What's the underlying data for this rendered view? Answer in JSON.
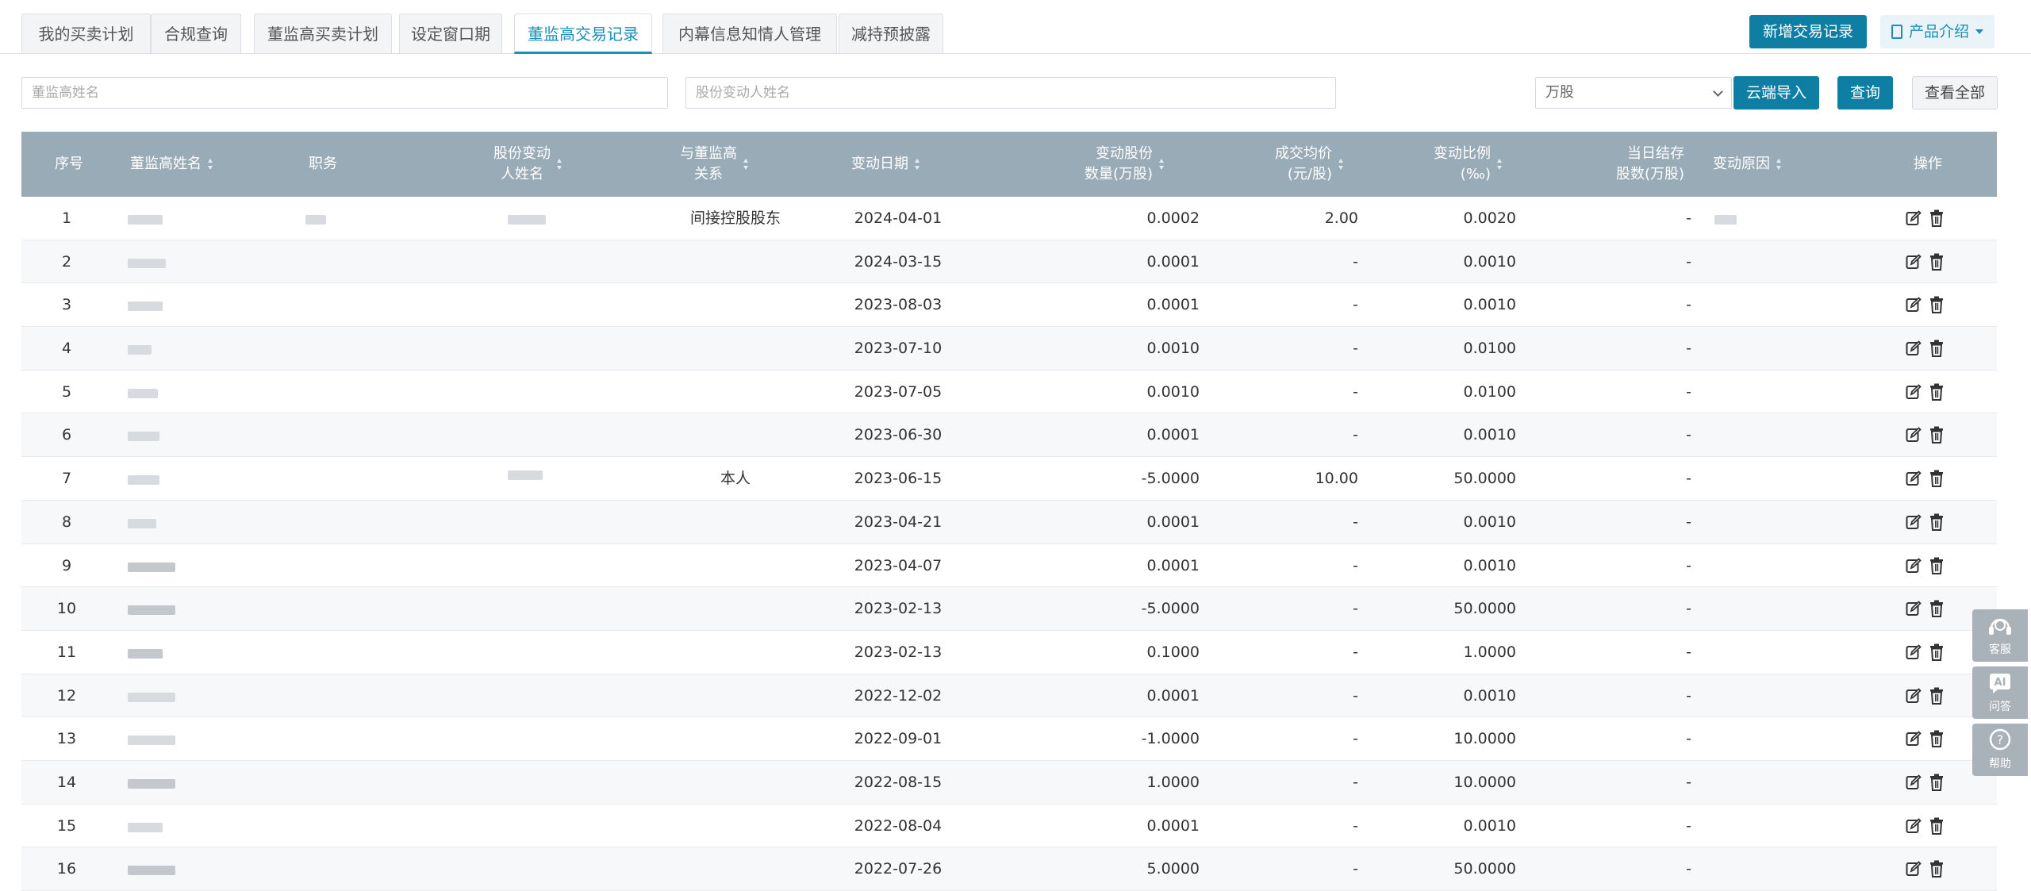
{
  "tabs": [
    {
      "label": "我的买卖计划",
      "active": false
    },
    {
      "label": "合规查询",
      "active": false
    },
    {
      "label": "董监高买卖计划",
      "active": false
    },
    {
      "label": "设定窗口期",
      "active": false
    },
    {
      "label": "董监高交易记录",
      "active": true
    },
    {
      "label": "内幕信息知情人管理",
      "active": false
    },
    {
      "label": "减持预披露",
      "active": false
    }
  ],
  "header_actions": {
    "new_record": "新增交易记录",
    "product_intro": "产品介绍"
  },
  "filters": {
    "name_placeholder": "董监高姓名",
    "changer_placeholder": "股份变动人姓名",
    "select_value": "万股",
    "import_button": "云端导入",
    "query_button": "查询",
    "query_all_button": "查看全部"
  },
  "columns": [
    {
      "label": "序号",
      "sortable": false
    },
    {
      "label": "董监高姓名",
      "sortable": true
    },
    {
      "label": "职务",
      "sortable": false
    },
    {
      "label": "股份变动\n人姓名",
      "sortable": true
    },
    {
      "label": "与董监高\n关系",
      "sortable": true
    },
    {
      "label": "变动日期",
      "sortable": true
    },
    {
      "label": "变动股份\n数量(万股)",
      "sortable": true
    },
    {
      "label": "成交均价\n(元/股)",
      "sortable": true
    },
    {
      "label": "变动比例\n(‰)",
      "sortable": true
    },
    {
      "label": "当日结存\n股数(万股)",
      "sortable": false
    },
    {
      "label": "变动原因",
      "sortable": true
    },
    {
      "label": "操作",
      "sortable": false
    }
  ],
  "rows": [
    {
      "no": "1",
      "relation": "间接控股股东",
      "date": "2024-04-01",
      "qty": "0.0002",
      "price": "2.00",
      "ratio": "0.0020",
      "balance": "-"
    },
    {
      "no": "2",
      "relation": "",
      "date": "2024-03-15",
      "qty": "0.0001",
      "price": "-",
      "ratio": "0.0010",
      "balance": "-"
    },
    {
      "no": "3",
      "relation": "",
      "date": "2023-08-03",
      "qty": "0.0001",
      "price": "-",
      "ratio": "0.0010",
      "balance": "-"
    },
    {
      "no": "4",
      "relation": "",
      "date": "2023-07-10",
      "qty": "0.0010",
      "price": "-",
      "ratio": "0.0100",
      "balance": "-"
    },
    {
      "no": "5",
      "relation": "",
      "date": "2023-07-05",
      "qty": "0.0010",
      "price": "-",
      "ratio": "0.0100",
      "balance": "-"
    },
    {
      "no": "6",
      "relation": "",
      "date": "2023-06-30",
      "qty": "0.0001",
      "price": "-",
      "ratio": "0.0010",
      "balance": "-"
    },
    {
      "no": "7",
      "relation": "本人",
      "date": "2023-06-15",
      "qty": "-5.0000",
      "price": "10.00",
      "ratio": "50.0000",
      "balance": "-"
    },
    {
      "no": "8",
      "relation": "",
      "date": "2023-04-21",
      "qty": "0.0001",
      "price": "-",
      "ratio": "0.0010",
      "balance": "-"
    },
    {
      "no": "9",
      "relation": "",
      "date": "2023-04-07",
      "qty": "0.0001",
      "price": "-",
      "ratio": "0.0010",
      "balance": "-"
    },
    {
      "no": "10",
      "relation": "",
      "date": "2023-02-13",
      "qty": "-5.0000",
      "price": "-",
      "ratio": "50.0000",
      "balance": "-"
    },
    {
      "no": "11",
      "relation": "",
      "date": "2023-02-13",
      "qty": "0.1000",
      "price": "-",
      "ratio": "1.0000",
      "balance": "-"
    },
    {
      "no": "12",
      "relation": "",
      "date": "2022-12-02",
      "qty": "0.0001",
      "price": "-",
      "ratio": "0.0010",
      "balance": "-"
    },
    {
      "no": "13",
      "relation": "",
      "date": "2022-09-01",
      "qty": "-1.0000",
      "price": "-",
      "ratio": "10.0000",
      "balance": "-"
    },
    {
      "no": "14",
      "relation": "",
      "date": "2022-08-15",
      "qty": "1.0000",
      "price": "-",
      "ratio": "10.0000",
      "balance": "-"
    },
    {
      "no": "15",
      "relation": "",
      "date": "2022-08-04",
      "qty": "0.0001",
      "price": "-",
      "ratio": "0.0010",
      "balance": "-"
    },
    {
      "no": "16",
      "relation": "",
      "date": "2022-07-26",
      "qty": "5.0000",
      "price": "-",
      "ratio": "50.0000",
      "balance": "-"
    }
  ],
  "float_widgets": [
    {
      "label": "客服",
      "icon": "headset-icon"
    },
    {
      "label": "问答",
      "icon": "ai-icon"
    },
    {
      "label": "帮助",
      "icon": "question-icon"
    }
  ],
  "colors": {
    "accent": "#0e7fa3",
    "header_bg": "#9aabb8",
    "active_tab": "#1a8fb9"
  }
}
